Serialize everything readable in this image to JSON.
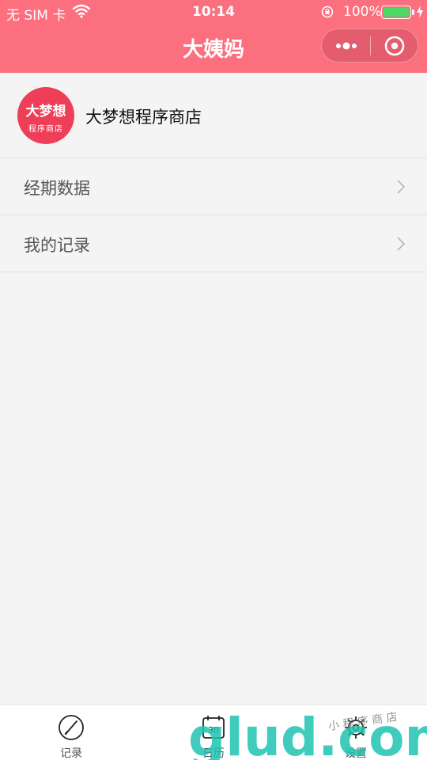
{
  "status_bar": {
    "carrier": "无 SIM 卡",
    "time": "10:14",
    "battery_percent": "100%",
    "battery_level": 1.0
  },
  "nav": {
    "title": "大姨妈"
  },
  "profile": {
    "avatar_line1": "大梦想",
    "avatar_line2": "程序商店",
    "name": "大梦想程序商店"
  },
  "menu": [
    {
      "label": "经期数据"
    },
    {
      "label": "我的记录"
    }
  ],
  "tabs": [
    {
      "label": "记录",
      "icon": "record-icon"
    },
    {
      "label": "日历",
      "icon": "calendar-icon",
      "icon_text": "30"
    },
    {
      "label": "设置",
      "icon": "settings-icon"
    }
  ],
  "watermark": {
    "text": "glud.com",
    "subtext": "小 程 序 商 店"
  },
  "colors": {
    "brand": "#fb6f7f",
    "avatar": "#ef3f58",
    "background": "#f4f4f4",
    "battery": "#4cd964"
  }
}
